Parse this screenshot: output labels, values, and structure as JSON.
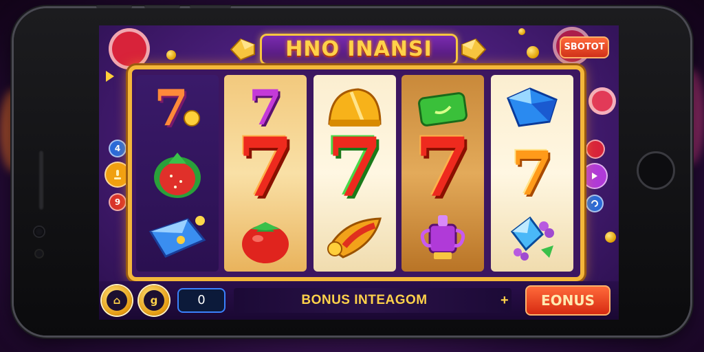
{
  "game": {
    "title": "HNO INANSI",
    "top_button_label": "SBOTOT"
  },
  "reels": [
    {
      "style": "dark",
      "symbols": [
        "seven-orange-with-coin",
        "strawberry",
        "blue-gem-ticket"
      ]
    },
    {
      "style": "light",
      "symbols": [
        "seven-purple",
        "seven-red",
        "tomato"
      ]
    },
    {
      "style": "pale",
      "symbols": [
        "golden-helmet",
        "seven-red-green-outline",
        "golden-horn"
      ]
    },
    {
      "style": "warm",
      "symbols": [
        "green-cash-bundle",
        "seven-red",
        "purple-trophy"
      ]
    },
    {
      "style": "pale",
      "symbols": [
        "blue-crystal",
        "seven-orange",
        "blue-gem-with-grapes"
      ]
    }
  ],
  "seven_glyph": "7",
  "side_buttons": {
    "left": [
      "4",
      "",
      "9"
    ],
    "right": [
      "",
      "",
      ""
    ]
  },
  "bottom_bar": {
    "left_button_icon": "lock-icon",
    "left_button_glyph": "⌂",
    "second_button_glyph": "g",
    "credit_value": "0",
    "bonus_message": "BONUS INTEAGOM",
    "plus_glyph": "+",
    "bonus_button_label": "EONUS"
  },
  "colors": {
    "frame_gold": "#f4b73a",
    "title_gold": "#ffd24a",
    "screen_purple": "#4b1f7c",
    "button_red": "#d62a12"
  }
}
